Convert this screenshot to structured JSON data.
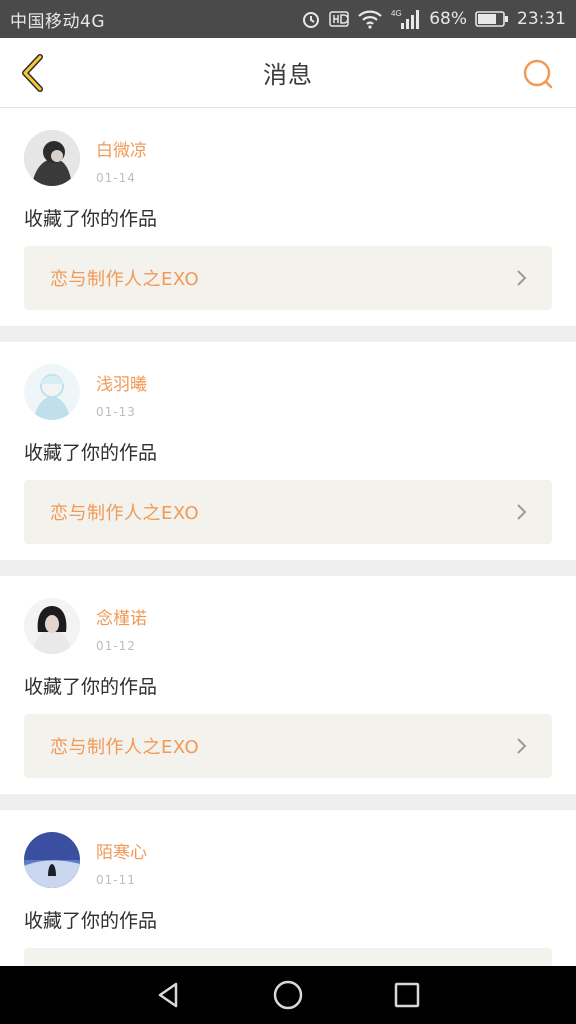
{
  "statusbar": {
    "carrier": "中国移动4G",
    "network": "4G",
    "battery": "68%",
    "time": "23:31"
  },
  "header": {
    "title": "消息",
    "back_icon": "chevron-left-icon",
    "search_icon": "search-icon",
    "accent": "#f09a58"
  },
  "messages": [
    {
      "user": "白微凉",
      "date": "01-14",
      "action": "收藏了你的作品",
      "work": "恋与制作人之EXO",
      "avatar": "avatar-1"
    },
    {
      "user": "浅羽曦",
      "date": "01-13",
      "action": "收藏了你的作品",
      "work": "恋与制作人之EXO",
      "avatar": "avatar-2"
    },
    {
      "user": "念槿诺",
      "date": "01-12",
      "action": "收藏了你的作品",
      "work": "恋与制作人之EXO",
      "avatar": "avatar-3"
    },
    {
      "user": "陌寒心",
      "date": "01-11",
      "action": "收藏了你的作品",
      "work": "",
      "avatar": "avatar-4"
    }
  ],
  "system_nav": {
    "back": "back-triangle-icon",
    "home": "home-circle-icon",
    "recent": "recent-square-icon"
  }
}
